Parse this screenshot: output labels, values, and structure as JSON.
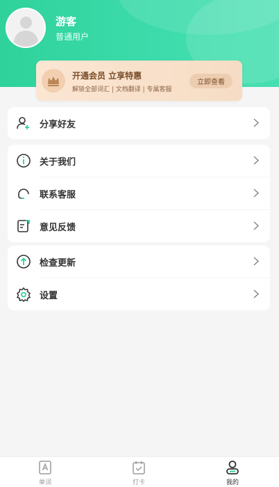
{
  "profile": {
    "name": "游客",
    "role": "普通用户"
  },
  "vip": {
    "title": "开通会员 立享特惠",
    "subtitle": "解锁全部词汇 | 文档翻译 | 专属客服",
    "button": "立即查看"
  },
  "menu": {
    "share": "分享好友",
    "about": "关于我们",
    "service": "联系客服",
    "feedback": "意见反馈",
    "update": "检查更新",
    "settings": "设置"
  },
  "tabs": {
    "words": "单词",
    "checkin": "打卡",
    "mine": "我的"
  },
  "colors": {
    "accent": "#2fd29b",
    "vip_bg": "#fbe6d3",
    "vip_text": "#7a4e2b"
  }
}
